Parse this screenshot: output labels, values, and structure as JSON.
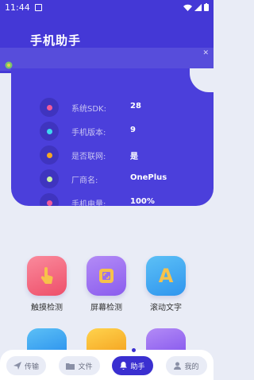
{
  "statusbar": {
    "time": "11:44"
  },
  "header": {
    "title": "手机助手"
  },
  "device_info": [
    {
      "label": "系统SDK:",
      "value": "28",
      "dot_color": "#f05a9a"
    },
    {
      "label": "手机版本:",
      "value": "9",
      "dot_color": "#3fd6f0"
    },
    {
      "label": "是否联网:",
      "value": "是",
      "dot_color": "#f5a623"
    },
    {
      "label": "厂商名:",
      "value": "OnePlus",
      "dot_color": "#c8f0a8"
    },
    {
      "label": "手机电量:",
      "value": "100%",
      "dot_color": "#f05a9a"
    }
  ],
  "tools": [
    {
      "label": "触摸检测",
      "icon": "touch-hand-icon",
      "color": "#f2607a"
    },
    {
      "label": "屏幕检测",
      "icon": "screen-frame-icon",
      "color": "#9b6cf2"
    },
    {
      "label": "滚动文字",
      "icon": "letter-a-icon",
      "color": "#3ba7f2"
    }
  ],
  "bottom_nav": {
    "transfer": "传输",
    "files": "文件",
    "assistant": "助手",
    "mine": "我的"
  }
}
